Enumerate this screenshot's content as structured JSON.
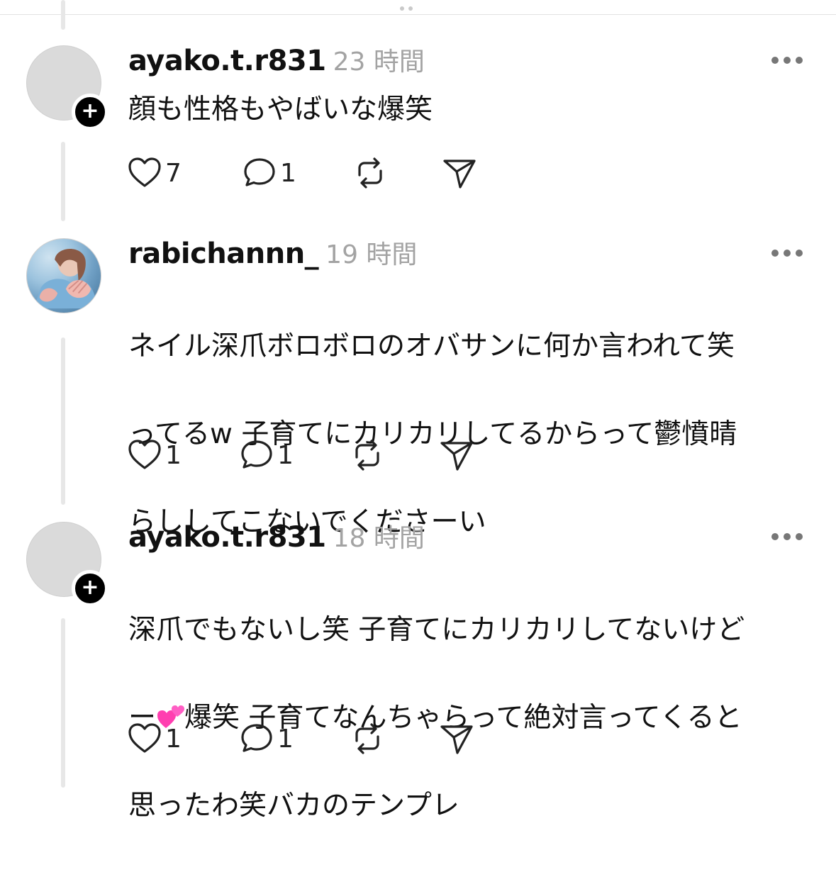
{
  "posts": [
    {
      "username": "ayako.t.r831",
      "time": "23 時間",
      "text": "顔も性格もやばいな爆笑",
      "likes": "7",
      "replies": "1",
      "avatar": "default-avatar",
      "has_follow_badge": true
    },
    {
      "username": "rabichannn_",
      "time": "19 時間",
      "text_lines": [
        "ネイル深爪ボロボロのオバサンに何か言われて笑",
        "ってるw 子育てにカリカリしてるからって鬱憤晴",
        "らししてこないでくださーい"
      ],
      "likes": "1",
      "replies": "1",
      "avatar": "photo-avatar",
      "has_follow_badge": false
    },
    {
      "username": "ayako.t.r831",
      "time": "18 時間",
      "text_line1": "深爪でもないし笑  子育てにカリカリしてないけど",
      "text_line2_pre": "ー",
      "text_line2_emoji": "two-hearts-emoji",
      "text_line2_post": "爆笑 子育てなんちゃらって絶対言ってくると",
      "text_line3": "思ったわ笑バカのテンプレ",
      "likes": "1",
      "replies": "1",
      "avatar": "default-avatar",
      "has_follow_badge": true
    }
  ],
  "icons": {
    "like": "heart-outline-icon",
    "reply": "comment-bubble-icon",
    "repost": "repost-arrows-icon",
    "share": "send-paper-plane-icon",
    "more": "more-options-icon"
  },
  "colors": {
    "text": "#111111",
    "muted": "#a3a3a3",
    "thread_line": "#e7e7e7",
    "emoji_pink": "#ff3fb0"
  }
}
